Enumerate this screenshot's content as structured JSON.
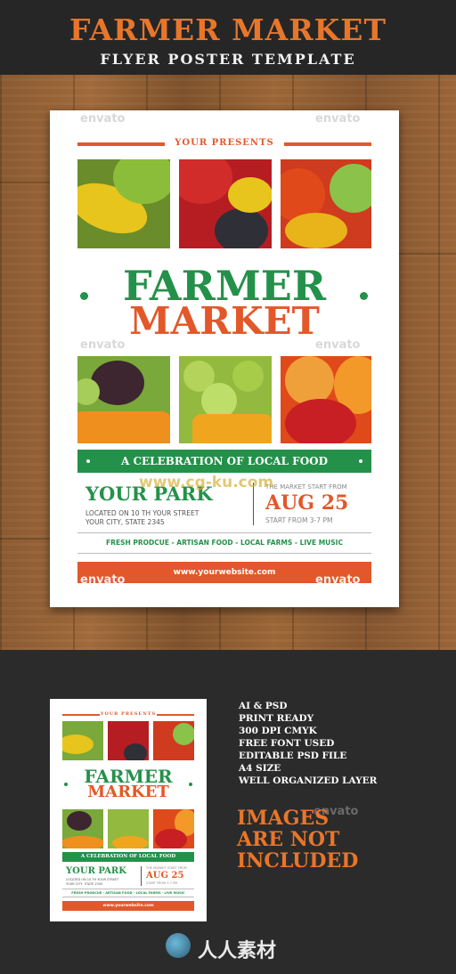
{
  "header": {
    "title": "FARMER MARKET",
    "subtitle": "FLYER POSTER TEMPLATE"
  },
  "watermark": "envato",
  "site_watermark": "www.cg-ku.com",
  "flyer": {
    "presents": "YOUR PRESENTS",
    "title_line1": "FARMER",
    "title_line2": "MARKET",
    "banner": "A CELEBRATION OF LOCAL FOOD",
    "park": "YOUR PARK",
    "address_line1": "LOCATED ON 10 TH YOUR STREET",
    "address_line2": "YOUR CITY, STATE 2345",
    "start_label": "THE MARKET START FROM",
    "date": "AUG 25",
    "time": "START FROM 3-7 PM",
    "tags": "FRESH PRODCUE - ARTISAN FOOD - LOCAL FARMS - LIVE MUSIC",
    "website": "www.yourwebsite.com"
  },
  "features": [
    "AI & PSD",
    "PRINT READY",
    "300 DPI CMYK",
    "FREE FONT USED",
    "EDITABLE PSD FILE",
    "A4 SIZE",
    "WELL ORGANIZED LAYER"
  ],
  "not_included": [
    "IMAGES",
    "ARE NOT",
    "INCLUDED"
  ],
  "brand": "人人素材",
  "colors": {
    "green": "#24914a",
    "orange": "#e2582a",
    "title_orange": "#e8762a"
  }
}
